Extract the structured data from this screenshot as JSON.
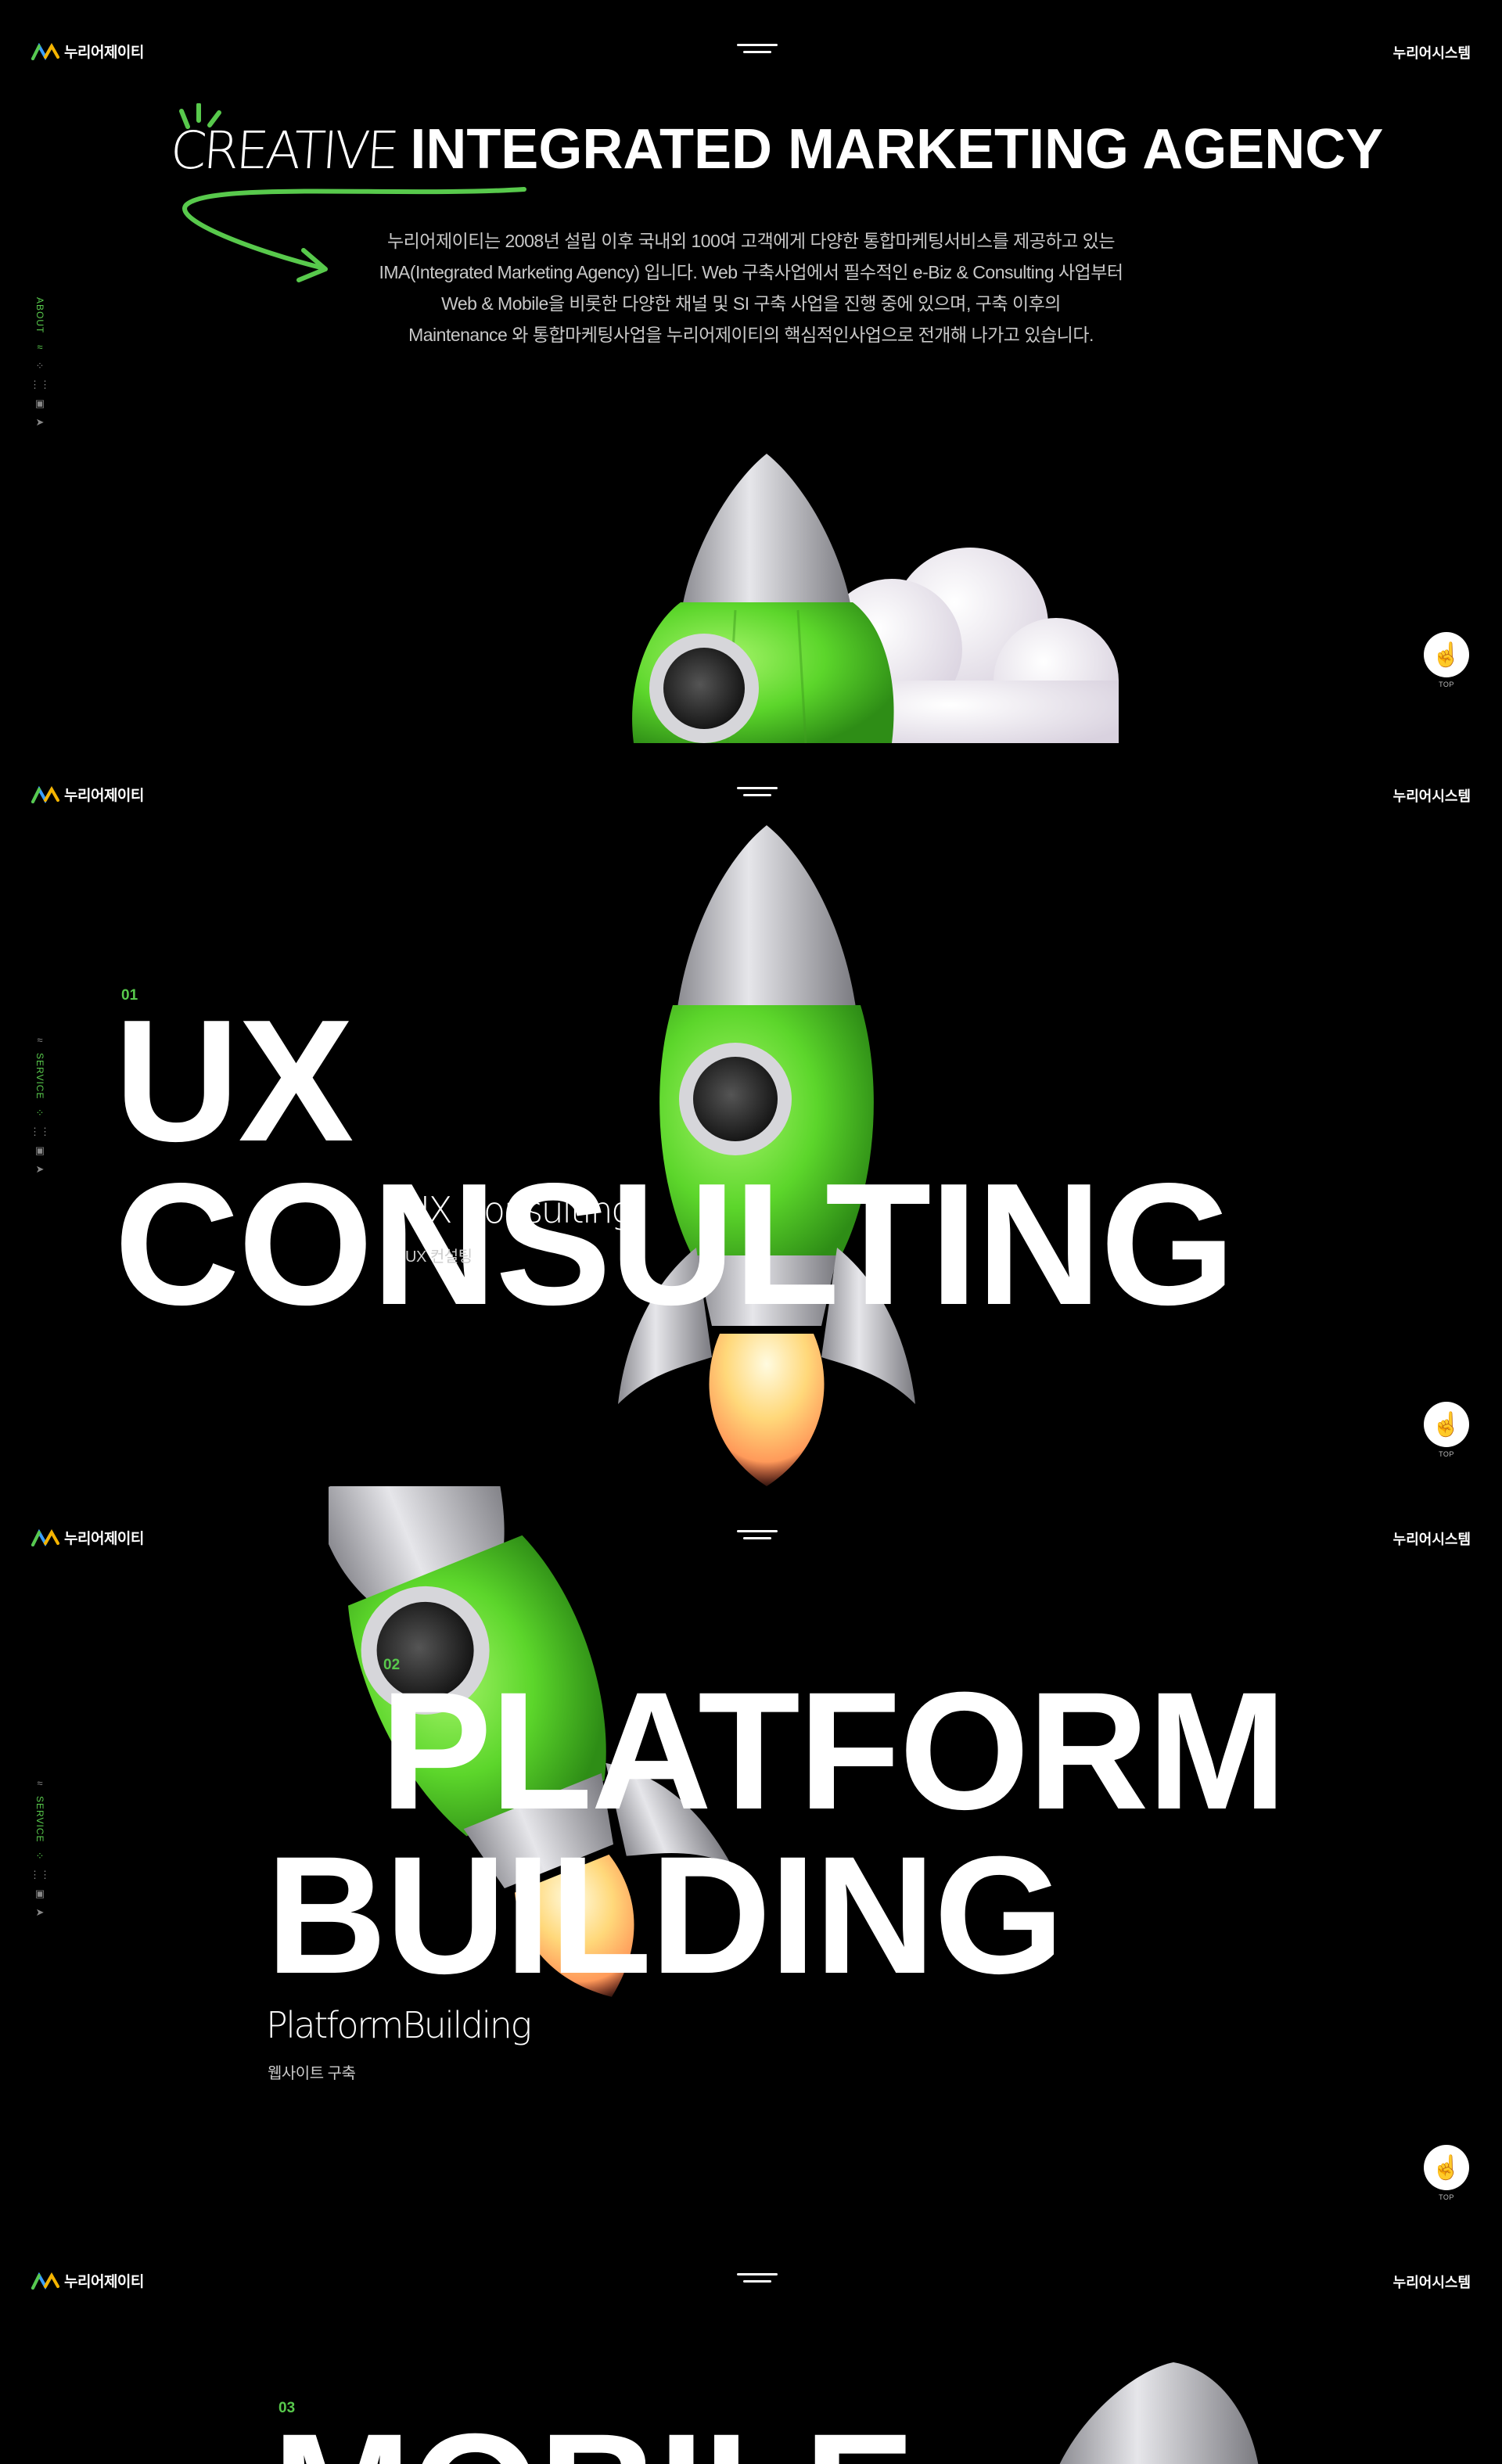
{
  "header": {
    "logo_text": "누리어제이티",
    "system_link": "누리어시스템",
    "menu_icon": "hamburger-menu-icon"
  },
  "side_nav": {
    "about_label": "ABOUT",
    "service_label": "SERVICE",
    "icons": [
      "logo-mark-icon",
      "grid-dots-icon",
      "apps-grid-icon",
      "briefcase-icon",
      "send-icon"
    ]
  },
  "top_button": {
    "label": "TOP",
    "icon": "pointing-hand-icon"
  },
  "intro": {
    "title_script": "CREATIVE",
    "title_main": "INTEGRATED MARKETING AGENCY",
    "desc_lines": [
      "누리어제이티는 2008년 설립 이후 국내외 100여 고객에게 다양한 통합마케팅서비스를 제공하고 있는",
      "IMA(Integrated Marketing Agency) 입니다. Web 구축사업에서 필수적인 e-Biz & Consulting 사업부터",
      "Web & Mobile을 비롯한 다양한 채널 및 SI 구축 사업을 진행 중에 있으며, 구축 이후의",
      "Maintenance 와  통합마케팅사업을 누리어제이티의 핵심적인사업으로 전개해 나가고 있습니다."
    ]
  },
  "services": [
    {
      "num": "01",
      "title": "UX CONSULTING",
      "script": "UX Consulting",
      "korean": "UX 컨설팅"
    },
    {
      "num": "02",
      "title_line1": "PLATFORM",
      "title_line2": "BUILDING",
      "script": "PlatformBuilding",
      "korean": "웹사이트 구축"
    },
    {
      "num": "03",
      "title": "MOBILE"
    }
  ],
  "colors": {
    "accent_green": "#58c94c",
    "rocket_green": "#6fe03a",
    "background": "#000000"
  }
}
